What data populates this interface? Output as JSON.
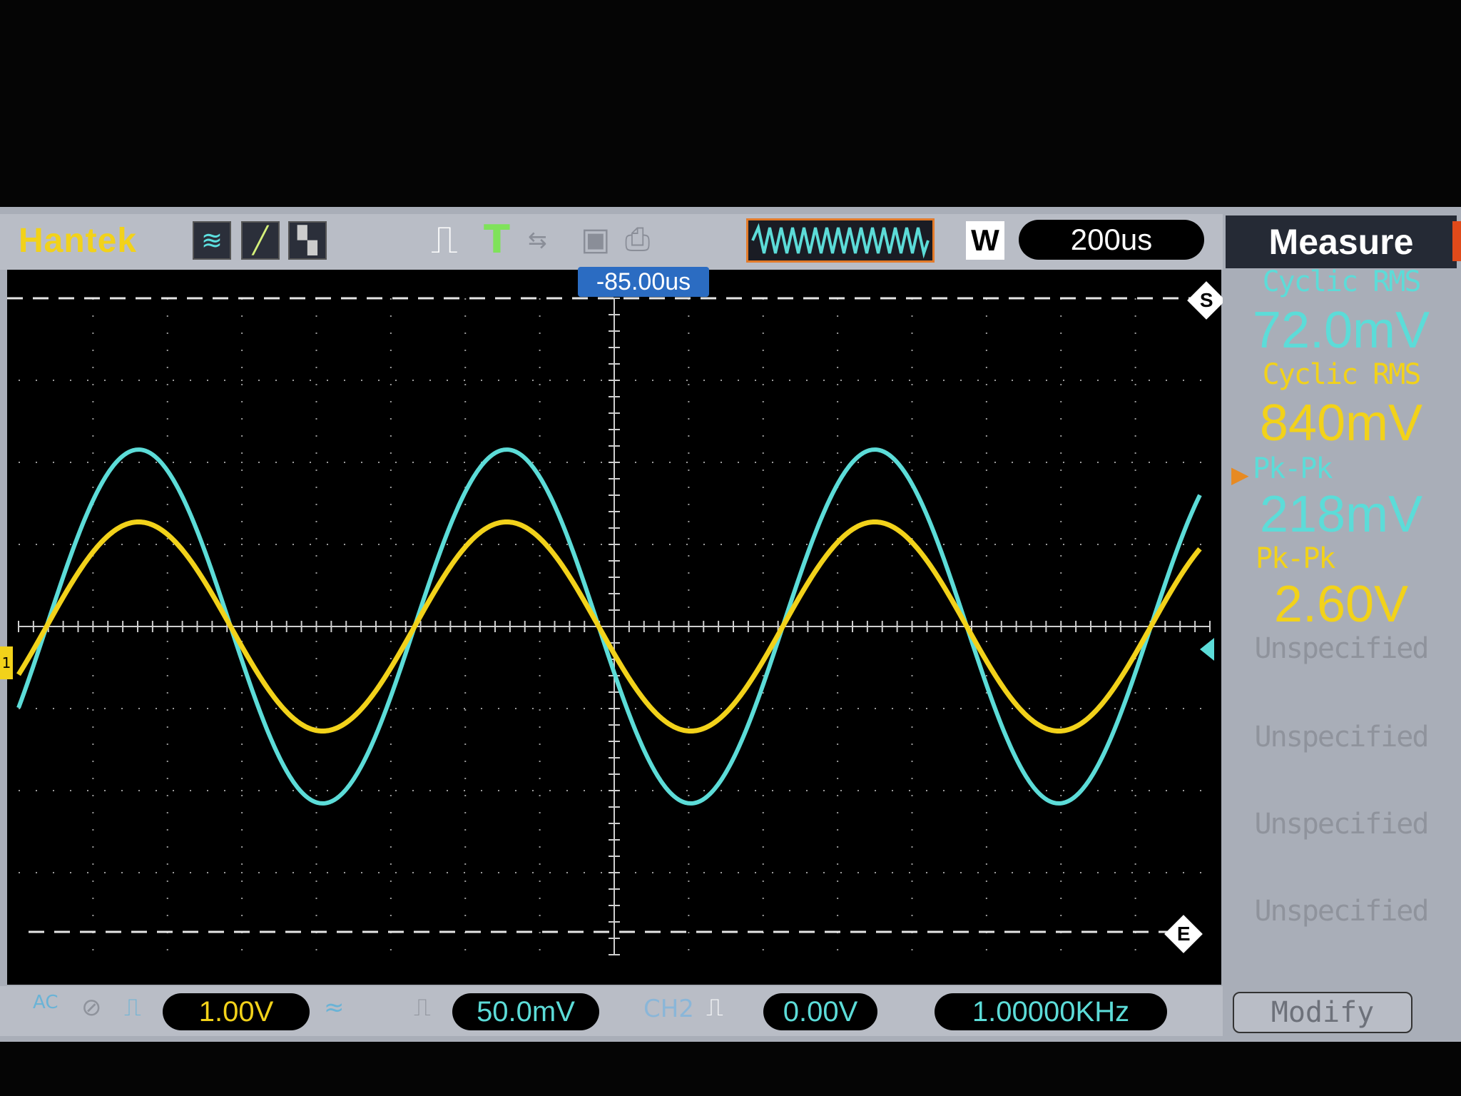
{
  "header": {
    "brand": "Hantek",
    "run_status_icon": "T",
    "buffer_label": "W",
    "timebase": "200us",
    "trigger_position": "-85.00us"
  },
  "markers": {
    "start": "S",
    "end": "E",
    "channel_marker": "1"
  },
  "measure": {
    "title": "Measure",
    "items": [
      {
        "label": "Cyclic RMS",
        "value": "72.0mV",
        "color": "#5cdcd8"
      },
      {
        "label": "Cyclic RMS",
        "value": "840mV",
        "color": "#f2d21a"
      },
      {
        "label": "Pk-Pk",
        "value": "218mV",
        "color": "#5cdcd8"
      },
      {
        "label": "Pk-Pk",
        "value": "2.60V",
        "color": "#f2d21a"
      },
      {
        "label": "Unspecified",
        "value": ""
      },
      {
        "label": "Unspecified",
        "value": ""
      },
      {
        "label": "Unspecified",
        "value": ""
      },
      {
        "label": "Unspecified",
        "value": ""
      }
    ],
    "modify_label": "Modify"
  },
  "status": {
    "ch1_coupling": "AC",
    "ch1_scale": "1.00V",
    "ch2_scale": "50.0mV",
    "trigger_source": "CH2",
    "trigger_level": "0.00V",
    "frequency": "1.00000KHz"
  },
  "colors": {
    "ch1": "#f2d21a",
    "ch2": "#5cdcd8",
    "accent": "#e37b2a"
  },
  "chart_data": {
    "type": "line",
    "title": "",
    "xlabel": "",
    "ylabel": "",
    "grid": true,
    "series": [
      {
        "name": "",
        "waveform": "sine",
        "frequency_hz": 1000,
        "peak_to_peak_divisions": 4.4,
        "color": "#5cdcd8"
      },
      {
        "name": "",
        "waveform": "sine",
        "frequency_hz": 1000,
        "peak_to_peak_divisions": 2.6,
        "color": "#f2d21a"
      }
    ],
    "x_divisions": 16,
    "y_divisions": 8
  }
}
